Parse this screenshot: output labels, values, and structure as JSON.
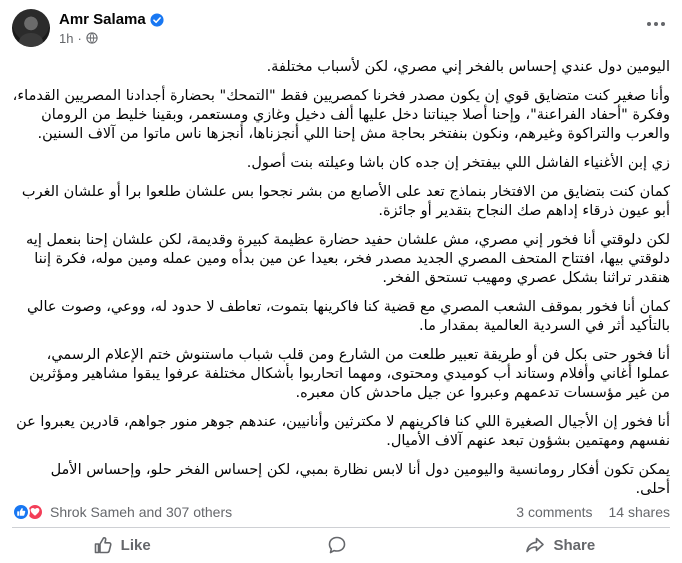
{
  "post": {
    "author": "Amr Salama",
    "time": "1h",
    "separator": "·",
    "paragraphs": [
      "اليومين دول عندي إحساس بالفخر إني مصري، لكن لأسباب مختلفة.",
      "وأنا صغير كنت متضايق قوي إن يكون مصدر فخرنا كمصريين فقط \"التمحك\" بحضارة أجدادنا المصريين القدماء، وفكرة \"أحفاد الفراعنة\"، وإحنا أصلا جيناتنا دخل عليها ألف دخيل وغازي ومستعمر، وبقينا خليط من الرومان والعرب والتراكوة وغيرهم، ونكون بنفتخر بحاجة مش إحنا اللي أنجزناها، أنجزها ناس ماتوا من آلاف السنين.",
      "زي إبن الأغنياء الفاشل اللي بيفتخر إن جده كان باشا وعيلته بنت أصول.",
      "كمان كنت بتضايق من الافتخار بنماذج تعد على الأصابع من بشر نجحوا بس علشان طلعوا برا أو علشان الغرب أبو عيون ذرقاء إداهم صك النجاح بتقدير أو جائزة.",
      "لكن دلوقتي أنا فخور إني مصري، مش علشان حفيد حضارة عظيمة كبيرة وقديمة، لكن علشان إحنا بنعمل إيه دلوقتي بيها، افتتاح المتحف المصري الجديد مصدر فخر، بعيدا عن مين بدأه ومين عمله ومين موله، فكرة إننا هنقدر تراثنا بشكل عصري ومهيب تستحق الفخر.",
      "كمان أنا فخور بموقف الشعب المصري مع قضية كنا فاكرينها بتموت، تعاطف لا حدود له، ووعي، وصوت عالي بالتأكيد أثر في السردية العالمية بمقدار ما.",
      "أنا فخور حتى بكل فن أو طريقة تعبير طلعت من الشارع ومن قلب شباب ماستنوش ختم الإعلام الرسمي، عملوا أغاني وأفلام وستاند أب كوميدي ومحتوى، ومهما اتحاربوا بأشكال مختلفة عرفوا يبقوا مشاهير ومؤثرين من غير مؤسسات تدعمهم وعبروا عن جيل ماحدش كان معبره.",
      "أنا فخور إن الأجيال الصغيرة اللي كنا فاكرينهم لا مكترثين وأنانيين، عندهم جوهر منور جواهم، قادرين يعبروا عن نفسهم ومهتمين بشؤون تبعد عنهم آلاف الأميال.",
      "يمكن تكون أفكار رومانسية واليومين دول أنا لابس نظارة بمبي، لكن إحساس الفخر حلو، وإحساس الأمل أحلى."
    ]
  },
  "engagement": {
    "reactors_text": "Shrok Sameh and 307 others",
    "comments": "3 comments",
    "shares": "14 shares"
  },
  "actions": {
    "like_label": "Like",
    "comment_label": "",
    "share_label": "Share"
  },
  "colors": {
    "brand_blue": "#1877f2",
    "love_red": "#f33e58",
    "muted_text": "#65676b"
  },
  "icons": [
    "avatar",
    "verified-badge-icon",
    "globe-icon",
    "more-options-icon",
    "like-reaction-icon",
    "love-reaction-icon",
    "like-icon",
    "comment-icon",
    "share-icon"
  ]
}
